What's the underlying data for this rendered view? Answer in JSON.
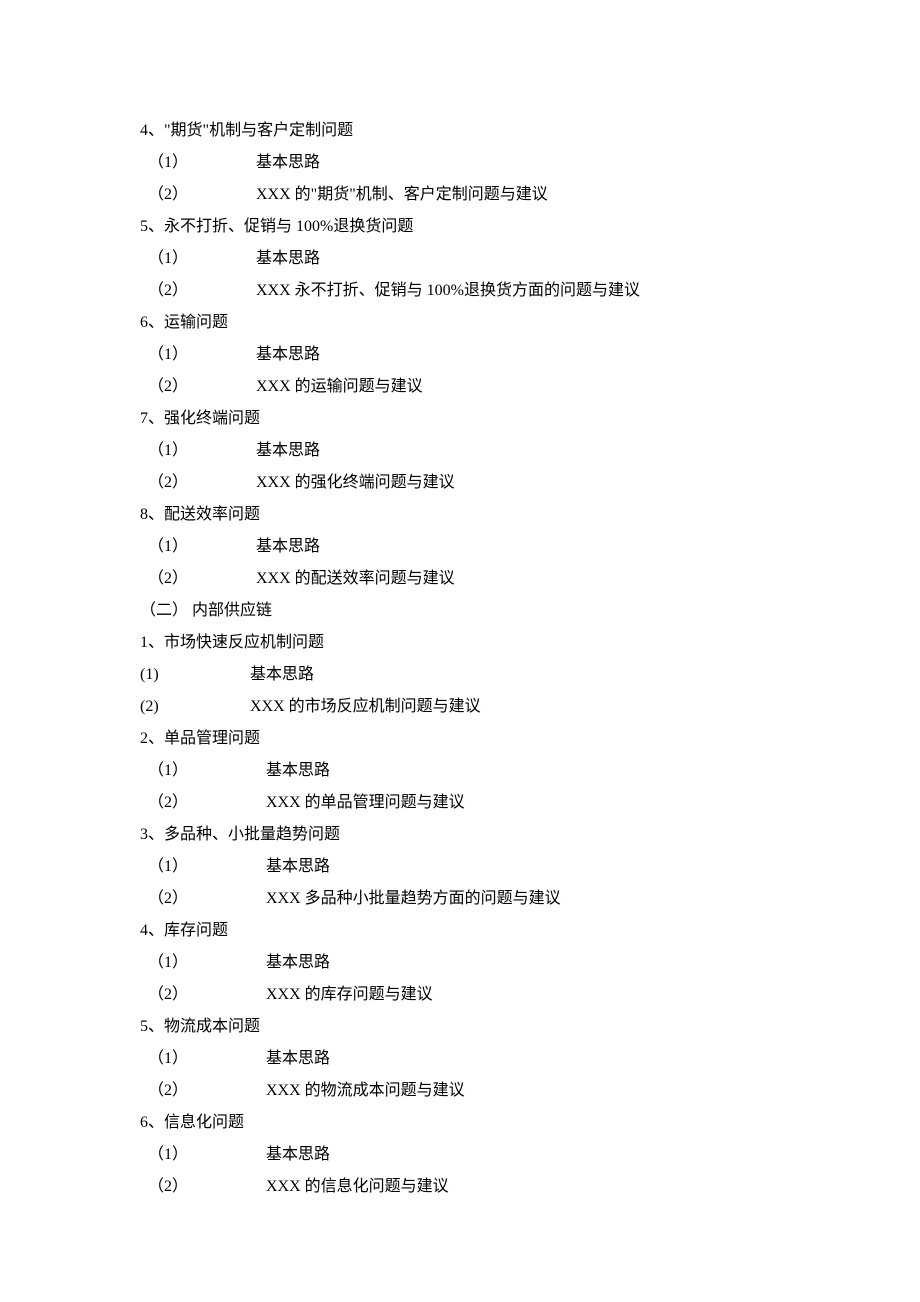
{
  "lines": [
    {
      "type": "heading",
      "text": "4、\"期货\"机制与客户定制问题"
    },
    {
      "type": "sub1",
      "label": "（1）",
      "text": "基本思路"
    },
    {
      "type": "sub1",
      "label": "（2）",
      "text": "XXX 的\"期货\"机制、客户定制问题与建议"
    },
    {
      "type": "heading",
      "text": "5、永不打折、促销与 100%退换货问题"
    },
    {
      "type": "sub1",
      "label": "（1）",
      "text": "基本思路"
    },
    {
      "type": "sub1",
      "label": "（2）",
      "text": "XXX 永不打折、促销与 100%退换货方面的问题与建议"
    },
    {
      "type": "heading",
      "text": "6、运输问题"
    },
    {
      "type": "sub1",
      "label": "（1）",
      "text": "基本思路"
    },
    {
      "type": "sub1",
      "label": "（2）",
      "text": "XXX 的运输问题与建议"
    },
    {
      "type": "heading",
      "text": "7、强化终端问题"
    },
    {
      "type": "sub1",
      "label": "（1）",
      "text": "基本思路"
    },
    {
      "type": "sub1",
      "label": "（2）",
      "text": "XXX 的强化终端问题与建议"
    },
    {
      "type": "heading",
      "text": "8、配送效率问题"
    },
    {
      "type": "sub1",
      "label": "（1）",
      "text": "基本思路"
    },
    {
      "type": "sub1",
      "label": "（2）",
      "text": "XXX 的配送效率问题与建议"
    },
    {
      "type": "section",
      "text": "（二） 内部供应链"
    },
    {
      "type": "heading",
      "text": "1、市场快速反应机制问题"
    },
    {
      "type": "sub1b",
      "label": "(1)",
      "text": "基本思路"
    },
    {
      "type": "sub1b",
      "label": "(2)",
      "text": "XXX 的市场反应机制问题与建议"
    },
    {
      "type": "heading",
      "text": "2、单品管理问题"
    },
    {
      "type": "sub2",
      "label": "（1）",
      "text": "基本思路"
    },
    {
      "type": "sub2",
      "label": "（2）",
      "text": "XXX 的单品管理问题与建议"
    },
    {
      "type": "heading",
      "text": "3、多品种、小批量趋势问题"
    },
    {
      "type": "sub2",
      "label": "（1）",
      "text": "基本思路"
    },
    {
      "type": "sub2",
      "label": "（2）",
      "text": "XXX 多品种小批量趋势方面的问题与建议"
    },
    {
      "type": "heading",
      "text": "4、库存问题"
    },
    {
      "type": "sub2",
      "label": "（1）",
      "text": "基本思路"
    },
    {
      "type": "sub2",
      "label": "（2）",
      "text": "XXX 的库存问题与建议"
    },
    {
      "type": "heading",
      "text": "5、物流成本问题"
    },
    {
      "type": "sub2",
      "label": "（1）",
      "text": "基本思路"
    },
    {
      "type": "sub2",
      "label": "（2）",
      "text": "XXX 的物流成本问题与建议"
    },
    {
      "type": "heading",
      "text": "6、信息化问题"
    },
    {
      "type": "sub2",
      "label": "（1）",
      "text": "基本思路"
    },
    {
      "type": "sub2",
      "label": "（2）",
      "text": "XXX 的信息化问题与建议"
    }
  ]
}
